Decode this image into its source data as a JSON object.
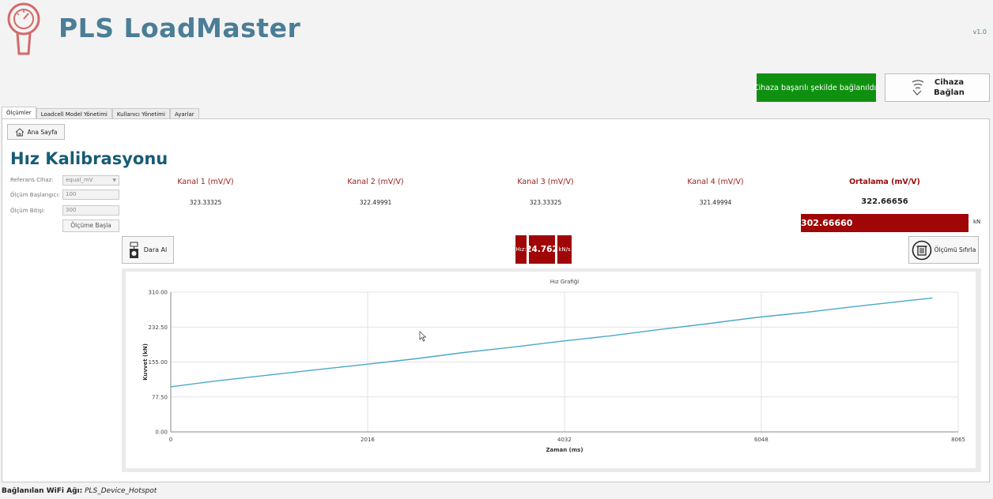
{
  "app": {
    "title": "PLS LoadMaster",
    "version": "v1.0",
    "logo_icon": "gauge-logo-icon",
    "brand_color": "#4b7d97",
    "accent_red": "#a00606",
    "success_green": "#109010"
  },
  "connection": {
    "status_text": "Cihaza başarılı şekilde bağlanıldı!",
    "connect_label_line1": "Cihaza",
    "connect_label_line2": "Bağlan",
    "connect_icon": "wireless-icon"
  },
  "tabs": [
    {
      "label": "Ölçümler",
      "active": true
    },
    {
      "label": "Loadcell Model Yönetimi",
      "active": false
    },
    {
      "label": "Kullanıcı Yönetimi",
      "active": false
    },
    {
      "label": "Ayarlar",
      "active": false
    }
  ],
  "main": {
    "home_button": "Ana Sayfa",
    "home_icon": "home-icon",
    "page_title": "Hız Kalibrasyonu",
    "form": {
      "reference_device_label": "Referans Cihaz:",
      "reference_device_value": "equal_mV",
      "start_label": "Ölçüm Başlangıcı:",
      "start_placeholder": "100",
      "end_label": "Ölçüm Bitişi:",
      "end_placeholder": "300",
      "start_button": "Ölçüme Başla"
    },
    "channels": [
      {
        "label": "Kanal 1 (mV/V)",
        "value": "323.33325"
      },
      {
        "label": "Kanal 2 (mV/V)",
        "value": "322.49991"
      },
      {
        "label": "Kanal 3 (mV/V)",
        "value": "323.33325"
      },
      {
        "label": "Kanal 4 (mV/V)",
        "value": "321.49994"
      }
    ],
    "average": {
      "label": "Ortalama (mV/V)",
      "value": "322.66656"
    },
    "force": {
      "value": "302.66660",
      "unit": "kN"
    },
    "tare_button": "Dara Al",
    "tare_icon": "scale-icon",
    "speed": {
      "label": "Hız:",
      "value": "24.762",
      "unit": "kN/s"
    },
    "reset_button": "Ölçümü Sıfırla",
    "reset_icon": "trash-icon"
  },
  "chart_data": {
    "type": "line",
    "title": "Hız Grafiği",
    "xlabel": "Zaman (ms)",
    "ylabel": "Kuvvet (kN)",
    "x_ticks": [
      "0",
      "2016",
      "4032",
      "6048",
      "8065"
    ],
    "y_ticks": [
      "0.00",
      "77.50",
      "155.00",
      "232.50",
      "310.00"
    ],
    "xlim": [
      0,
      8065
    ],
    "ylim": [
      0,
      310
    ],
    "grid": true,
    "line_color": "#4aa8c8",
    "series": [
      {
        "x": [
          0,
          500,
          1000,
          1500,
          2000,
          2500,
          3000,
          3500,
          4000,
          4500,
          5000,
          5500,
          6000,
          6500,
          7000,
          7500,
          7800
        ],
        "y": [
          100,
          114,
          126,
          138,
          150,
          162,
          176,
          188,
          201,
          213,
          227,
          240,
          254,
          265,
          278,
          290,
          297
        ]
      }
    ]
  },
  "footer": {
    "wifi_label": "Bağlanılan WiFi Ağı:",
    "wifi_value": "PLS_Device_Hotspot"
  }
}
